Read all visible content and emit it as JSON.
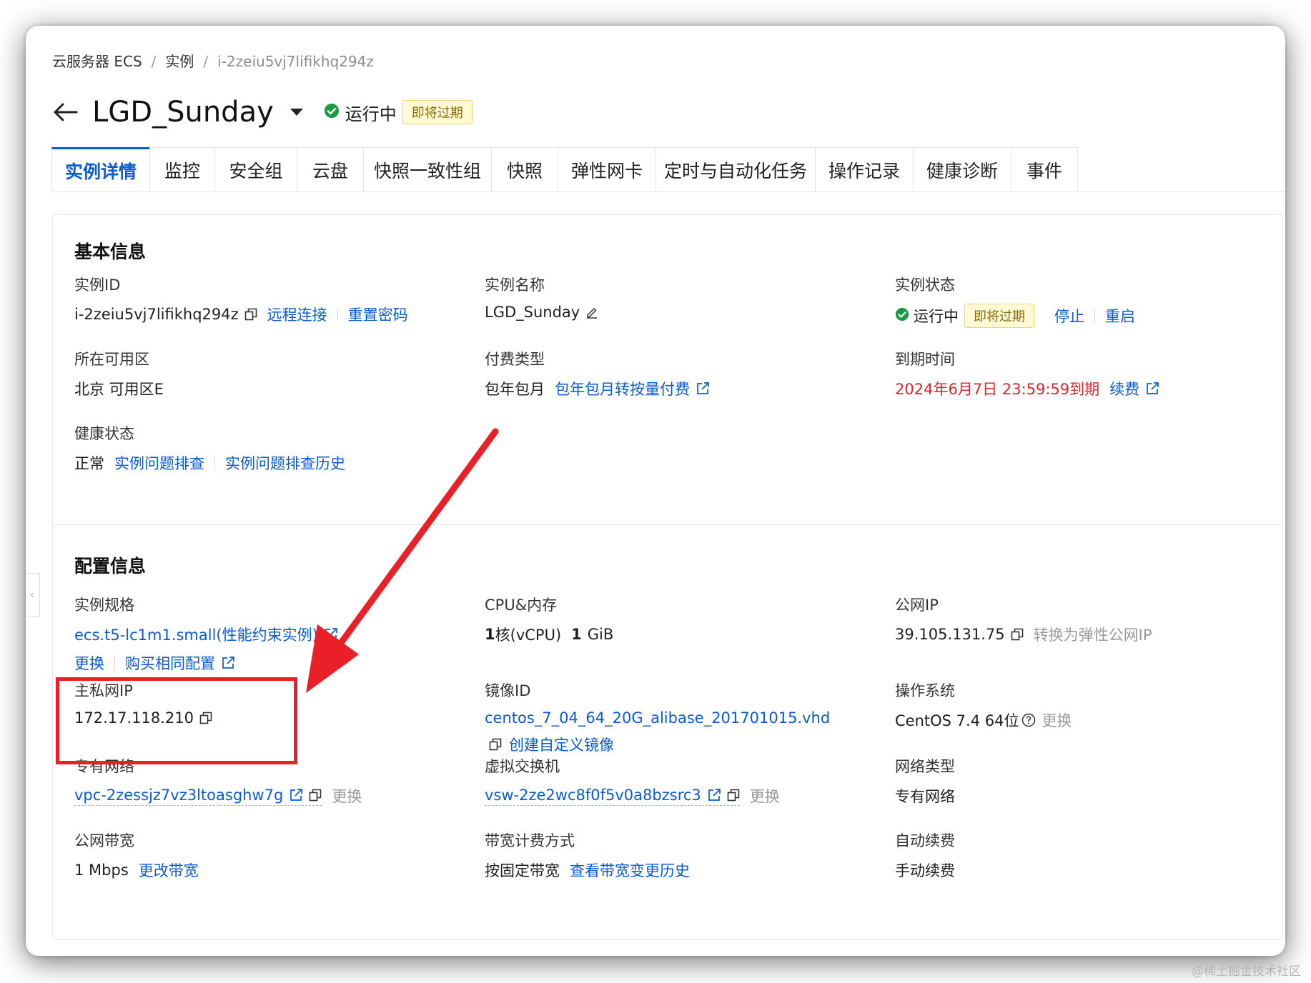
{
  "breadcrumb": {
    "root": "云服务器 ECS",
    "parent": "实例",
    "current": "i-2zeiu5vj7lifikhq294z"
  },
  "header": {
    "title": "LGD_Sunday",
    "status": "运行中",
    "badge": "即将过期"
  },
  "tabs": [
    "实例详情",
    "监控",
    "安全组",
    "云盘",
    "快照一致性组",
    "快照",
    "弹性网卡",
    "定时与自动化任务",
    "操作记录",
    "健康诊断",
    "事件"
  ],
  "basic": {
    "title": "基本信息",
    "instance_id": {
      "label": "实例ID",
      "value": "i-2zeiu5vj7lifikhq294z",
      "link1": "远程连接",
      "link2": "重置密码"
    },
    "instance_name": {
      "label": "实例名称",
      "value": "LGD_Sunday"
    },
    "instance_status": {
      "label": "实例状态",
      "value": "运行中",
      "badge": "即将过期",
      "link1": "停止",
      "link2": "重启"
    },
    "zone": {
      "label": "所在可用区",
      "value": "北京 可用区E"
    },
    "billing": {
      "label": "付费类型",
      "value": "包年包月",
      "link": "包年包月转按量付费"
    },
    "expire": {
      "label": "到期时间",
      "value": "2024年6月7日 23:59:59到期",
      "link": "续费"
    },
    "health": {
      "label": "健康状态",
      "value": "正常",
      "link1": "实例问题排查",
      "link2": "实例问题排查历史"
    }
  },
  "config": {
    "title": "配置信息",
    "spec": {
      "label": "实例规格",
      "value": "ecs.t5-lc1m1.small(性能约束实例)",
      "link1": "更换",
      "link2": "购买相同配置"
    },
    "cpu": {
      "label": "CPU&内存",
      "cpu_num": "1",
      "cpu_unit": "核(vCPU)",
      "mem_num": "1",
      "mem_unit": "GiB"
    },
    "public_ip": {
      "label": "公网IP",
      "value": "39.105.131.75",
      "action": "转换为弹性公网IP"
    },
    "private_ip": {
      "label": "主私网IP",
      "value": "172.17.118.210"
    },
    "image": {
      "label": "镜像ID",
      "value": "centos_7_04_64_20G_alibase_201701015.vhd",
      "link": "创建自定义镜像"
    },
    "os": {
      "label": "操作系统",
      "value": "CentOS 7.4 64位",
      "action": "更换"
    },
    "vpc": {
      "label": "专有网络",
      "value": "vpc-2zessjz7vz3ltoasghw7g",
      "action": "更换"
    },
    "vswitch": {
      "label": "虚拟交换机",
      "value": "vsw-2ze2wc8f0f5v0a8bzsrc3",
      "action": "更换"
    },
    "net_type": {
      "label": "网络类型",
      "value": "专有网络"
    },
    "bandwidth": {
      "label": "公网带宽",
      "value": "1 Mbps",
      "link": "更改带宽"
    },
    "bw_billing": {
      "label": "带宽计费方式",
      "value": "按固定带宽",
      "link": "查看带宽变更历史"
    },
    "auto_renew": {
      "label": "自动续费",
      "value": "手动续费"
    }
  },
  "watermark": "@稀土掘金技术社区",
  "colors": {
    "accent": "#0a5bd6",
    "success": "#1a9a42",
    "danger": "#e0262c",
    "warning_bg": "#fff9d6",
    "annotation": "#ea1f28"
  }
}
